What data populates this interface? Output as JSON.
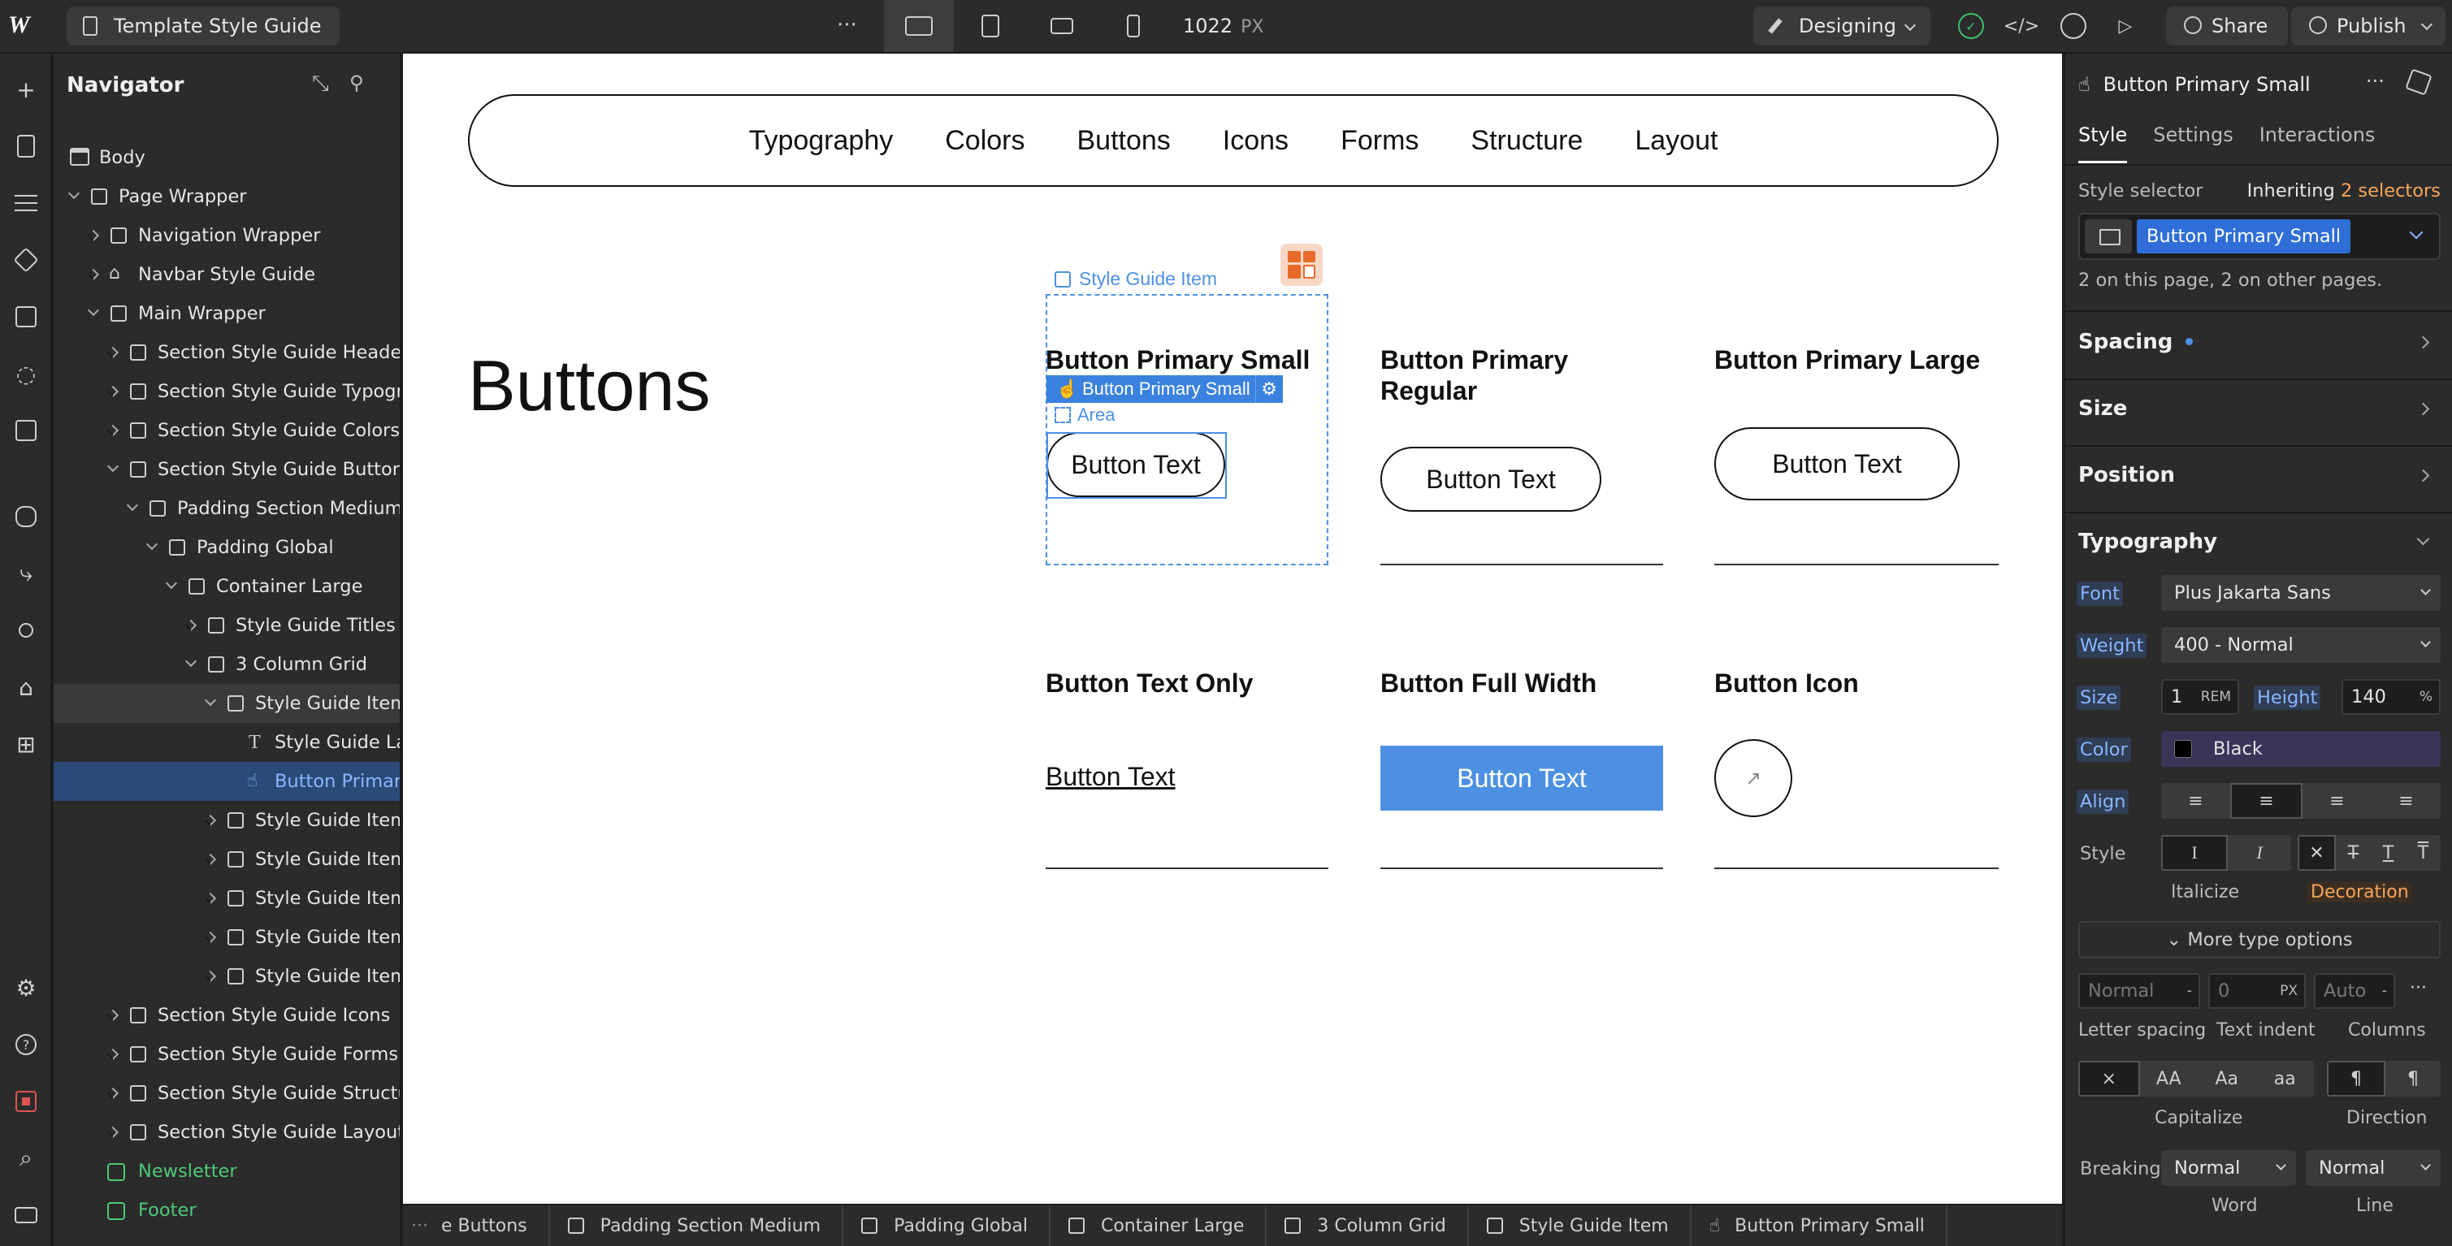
{
  "app": {
    "page_name": "Template Style Guide",
    "canvas_width": "1022",
    "canvas_unit": "PX",
    "mode": "Designing",
    "share_label": "Share",
    "publish_label": "Publish"
  },
  "navigator": {
    "title": "Navigator",
    "items": [
      {
        "label": "Body"
      },
      {
        "label": "Page Wrapper"
      },
      {
        "label": "Navigation Wrapper"
      },
      {
        "label": "Navbar Style Guide"
      },
      {
        "label": "Main Wrapper"
      },
      {
        "label": "Section Style Guide Header"
      },
      {
        "label": "Section Style Guide Typography"
      },
      {
        "label": "Section Style Guide Colors"
      },
      {
        "label": "Section Style Guide Buttons"
      },
      {
        "label": "Padding Section Medium"
      },
      {
        "label": "Padding Global"
      },
      {
        "label": "Container Large"
      },
      {
        "label": "Style Guide Titles"
      },
      {
        "label": "3 Column Grid"
      },
      {
        "label": "Style Guide Item"
      },
      {
        "label": "Style Guide Label"
      },
      {
        "label": "Button Primary Small"
      },
      {
        "label": "Style Guide Item"
      },
      {
        "label": "Style Guide Item"
      },
      {
        "label": "Style Guide Item"
      },
      {
        "label": "Style Guide Item"
      },
      {
        "label": "Style Guide Item"
      },
      {
        "label": "Section Style Guide Icons"
      },
      {
        "label": "Section Style Guide Forms"
      },
      {
        "label": "Section Style Guide Structure"
      },
      {
        "label": "Section Style Guide Layout"
      },
      {
        "label": "Newsletter"
      },
      {
        "label": "Footer"
      }
    ]
  },
  "canvas": {
    "nav_links": [
      "Typography",
      "Colors",
      "Buttons",
      "Icons",
      "Forms",
      "Structure",
      "Layout"
    ],
    "heading": "Buttons",
    "items": [
      {
        "title": "Button Primary Small",
        "button": "Button Text"
      },
      {
        "title": "Button Primary Regular",
        "button": "Button Text"
      },
      {
        "title": "Button Primary Large",
        "button": "Button Text"
      },
      {
        "title": "Button Text Only",
        "button": "Button Text"
      },
      {
        "title": "Button Full Width",
        "button": "Button Text"
      },
      {
        "title": "Button Icon",
        "button": "↗"
      }
    ],
    "selection": {
      "parent_label": "Style Guide Item",
      "tag_label": "Button Primary Small",
      "area_label": "Area"
    }
  },
  "breadcrumbs": [
    "e Buttons",
    "Padding Section Medium",
    "Padding Global",
    "Container Large",
    "3 Column Grid",
    "Style Guide Item",
    "Button Primary Small"
  ],
  "panel": {
    "element_name": "Button Primary Small",
    "tabs": [
      "Style",
      "Settings",
      "Interactions"
    ],
    "style_selector_label": "Style selector",
    "inheriting_text": "Inheriting",
    "inheriting_count": "2 selectors",
    "selector_chip": "Button Primary Small",
    "selector_note": "2 on this page, 2 on other pages.",
    "sections": {
      "spacing": "Spacing",
      "size": "Size",
      "position": "Position",
      "typography": "Typography"
    },
    "typography": {
      "font_label": "Font",
      "font_value": "Plus Jakarta Sans",
      "weight_label": "Weight",
      "weight_value": "400 - Normal",
      "size_label": "Size",
      "size_value": "1",
      "size_unit": "REM",
      "height_label": "Height",
      "height_value": "140",
      "height_unit": "%",
      "color_label": "Color",
      "color_value": "Black",
      "align_label": "Align",
      "style_label": "Style",
      "italicize_label": "Italicize",
      "decoration_label": "Decoration",
      "more_options": "More type options",
      "letter_spacing_value": "Normal",
      "letter_spacing_label": "Letter spacing",
      "text_indent_value": "0",
      "text_indent_unit": "PX",
      "text_indent_label": "Text indent",
      "columns_value": "Auto",
      "columns_label": "Columns",
      "capitalize_options": [
        "×",
        "AA",
        "Aa",
        "aa"
      ],
      "capitalize_label": "Capitalize",
      "direction_label": "Direction",
      "breaking_label": "Breaking",
      "word_value": "Normal",
      "word_label": "Word",
      "line_value": "Normal",
      "line_label": "Line"
    }
  },
  "colors": {
    "accent": "#4d90e2",
    "selection": "#2a4a78",
    "orange": "#f5a65b",
    "component": "#4fc978"
  }
}
